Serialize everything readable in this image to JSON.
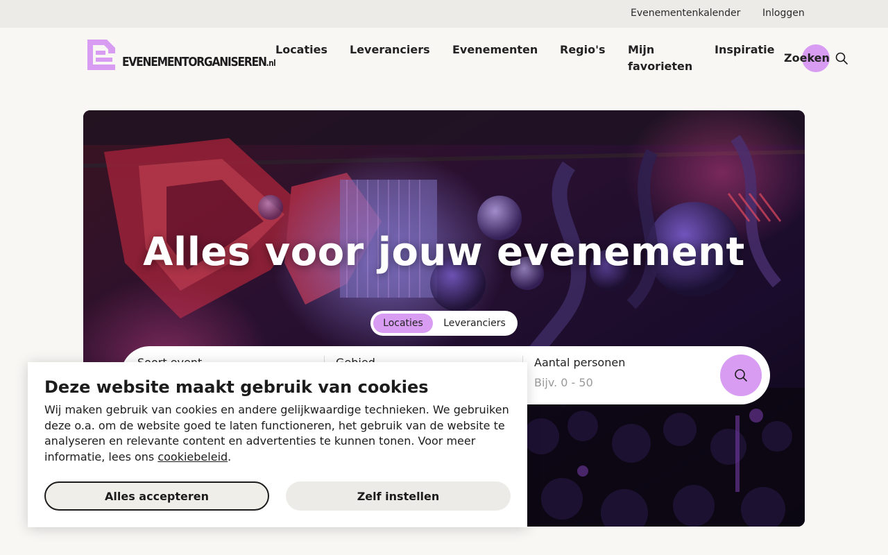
{
  "topbar": {
    "calendar": "Evenementenkalender",
    "login": "Inloggen"
  },
  "logo": {
    "text": "EVENEMENTORGANISEREN",
    "suffix": ".nl"
  },
  "nav": {
    "locaties": "Locaties",
    "leveranciers": "Leveranciers",
    "evenementen": "Evenementen",
    "regios": "Regio's",
    "favorieten": "Mijn favorieten",
    "inspiratie": "Inspiratie",
    "zoeken": "Zoeken"
  },
  "hero": {
    "title": "Alles voor jouw evenement",
    "toggle": {
      "active": "Locaties",
      "other": "Leveranciers"
    },
    "search": {
      "event_label": "Soort event",
      "area_label": "Gebied",
      "persons_label": "Aantal personen",
      "persons_placeholder": "Bijv. 0 - 50"
    }
  },
  "cookie": {
    "title": "Deze website maakt gebruik van cookies",
    "body": "Wij maken gebruik van cookies en andere gelijkwaardige technieken. We gebruiken deze o.a. om de website goed te laten functioneren, het gebruik van de website te analyseren en relevante content en advertenties te kunnen tonen. Voor meer informatie, lees ons",
    "link": "cookiebeleid",
    "period": ".",
    "accept": "Alles accepteren",
    "settings": "Zelf instellen"
  },
  "colors": {
    "accent": "#d89cf3",
    "page_bg": "#f8f7f4",
    "topbar_bg": "#ecebe7",
    "text": "#1c1c1c"
  },
  "icons": {
    "logo": "logo-e-icon",
    "search": "search-icon"
  }
}
